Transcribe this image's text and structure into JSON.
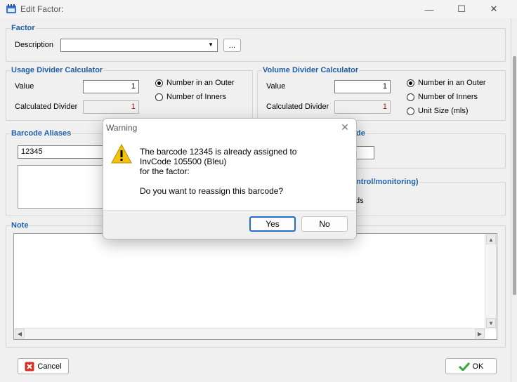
{
  "window": {
    "title": "Edit Factor:",
    "minimize_glyph": "—",
    "maximize_glyph": "☐",
    "close_glyph": "✕"
  },
  "factor": {
    "group_title": "Factor",
    "description_label": "Description",
    "description_value": "",
    "dropdown_glyph": "▼",
    "browse_label": "..."
  },
  "usage": {
    "group_title": "Usage Divider Calculator",
    "value_label": "Value",
    "value": "1",
    "calc_label": "Calculated Divider",
    "calc_value": "1",
    "radio_outer": "Number in an Outer",
    "radio_inners": "Number of Inners",
    "selected": "outer"
  },
  "volume": {
    "group_title": "Volume Divider Calculator",
    "value_label": "Value",
    "value": "1",
    "calc_label": "Calculated Divider",
    "calc_value": "1",
    "radio_outer": "Number in an Outer",
    "radio_inners": "Number of Inners",
    "radio_unit": "Unit Size (mls)",
    "selected": "outer"
  },
  "barcodes": {
    "group_title": "Barcode Aliases",
    "input_value": "12345",
    "partial_right_title": "de",
    "partial_right_title2": "ntrol/monitoring)",
    "partial_right_text": "ds"
  },
  "note": {
    "group_title": "Note",
    "value": "",
    "scroll_up": "▲",
    "scroll_down": "▼",
    "scroll_left": "◀",
    "scroll_right": "▶"
  },
  "footer": {
    "cancel_label": "Cancel",
    "ok_label": "OK"
  },
  "dialog": {
    "title": "Warning",
    "close_glyph": "✕",
    "icon_glyph": "!",
    "line1": "The barcode 12345 is already assigned to",
    "line2": "InvCode 105500 (Bleu)",
    "line3": "for the factor:",
    "question": "Do you want to reassign this barcode?",
    "yes_label": "Yes",
    "no_label": "No"
  },
  "colors": {
    "group_title": "#1f5ea8",
    "accent": "#1f6fd1",
    "calc_value": "#9a1a1a",
    "warning_yellow": "#f4c20d",
    "cancel_red": "#d93025",
    "ok_green": "#3ea53e"
  }
}
